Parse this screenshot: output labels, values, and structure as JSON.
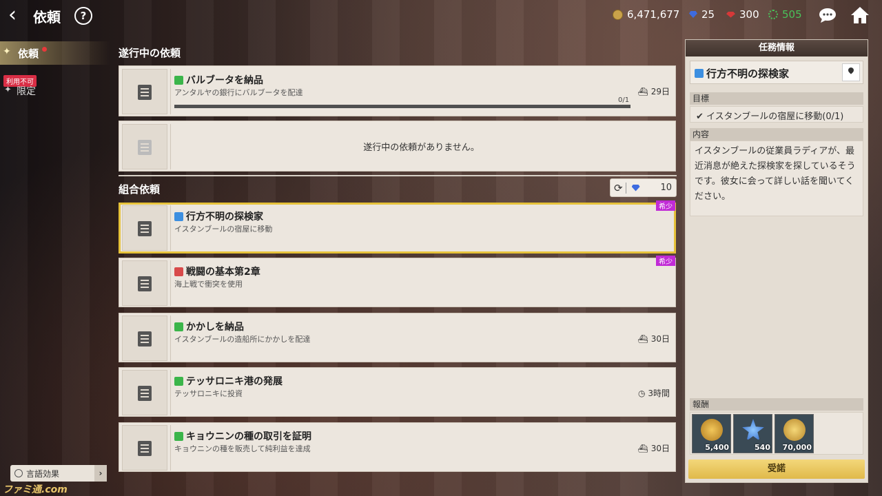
{
  "header": {
    "title": "依頼",
    "help": "?"
  },
  "currencies": {
    "gold": "6,471,677",
    "blue_gem": "25",
    "ruby": "300",
    "green": "505"
  },
  "nav": {
    "active_label": "依頼",
    "unavailable_badge": "利用不可",
    "limited_label": "限定",
    "lang_label": "言語効果",
    "watermark": "ファミ通.com"
  },
  "in_progress": {
    "section_title": "遂行中の依頼",
    "quest": {
      "title": "バルブータを納品",
      "desc": "アンタルヤの銀行にバルブータを配達",
      "progress": "0/1",
      "progress_fraction": 0.0,
      "days": "29日"
    },
    "empty_text": "遂行中の依頼がありません。"
  },
  "guild": {
    "section_title": "組合依頼",
    "refresh_cost": "10",
    "rare_label": "希少",
    "quests": [
      {
        "title": "行方不明の探検家",
        "desc": "イスタンブールの宿屋に移動",
        "meta": "",
        "icon": "blue",
        "rare": true,
        "selected": true
      },
      {
        "title": "戦闘の基本第2章",
        "desc": "海上戦で衝突を使用",
        "meta": "",
        "icon": "red",
        "rare": true,
        "selected": false
      },
      {
        "title": "かかしを納品",
        "desc": "イスタンブールの造船所にかかしを配達",
        "meta": "30日",
        "icon": "green",
        "rare": false,
        "selected": false
      },
      {
        "title": "テッサロニキ港の発展",
        "desc": "テッサロニキに投資",
        "meta": "3時間",
        "icon": "green",
        "rare": false,
        "selected": false
      },
      {
        "title": "キョウニンの種の取引を証明",
        "desc": "キョウニンの種を販売して純利益を達成",
        "meta": "30日",
        "icon": "green",
        "rare": false,
        "selected": false
      }
    ]
  },
  "mission_info": {
    "header": "任務情報",
    "title": "行方不明の探検家",
    "objective_header": "目標",
    "objective": "イスタンブールの宿屋に移動(0/1)",
    "content_header": "内容",
    "content": "イスタンブールの従業員ラディアが、最近消息が絶えた探検家を探しているそうです。彼女に会って詳しい話を聞いてください。",
    "reward_header": "報酬",
    "rewards": [
      {
        "icon": "medal-icon",
        "count": "5,400"
      },
      {
        "icon": "blue-emblem-icon",
        "count": "540"
      },
      {
        "icon": "gold-coin-icon",
        "count": "70,000"
      }
    ],
    "accept_label": "受諾"
  },
  "colors": {
    "accent_gold": "#e6c23a",
    "rare": "#c12bd6",
    "green_currency": "#49c25a"
  }
}
